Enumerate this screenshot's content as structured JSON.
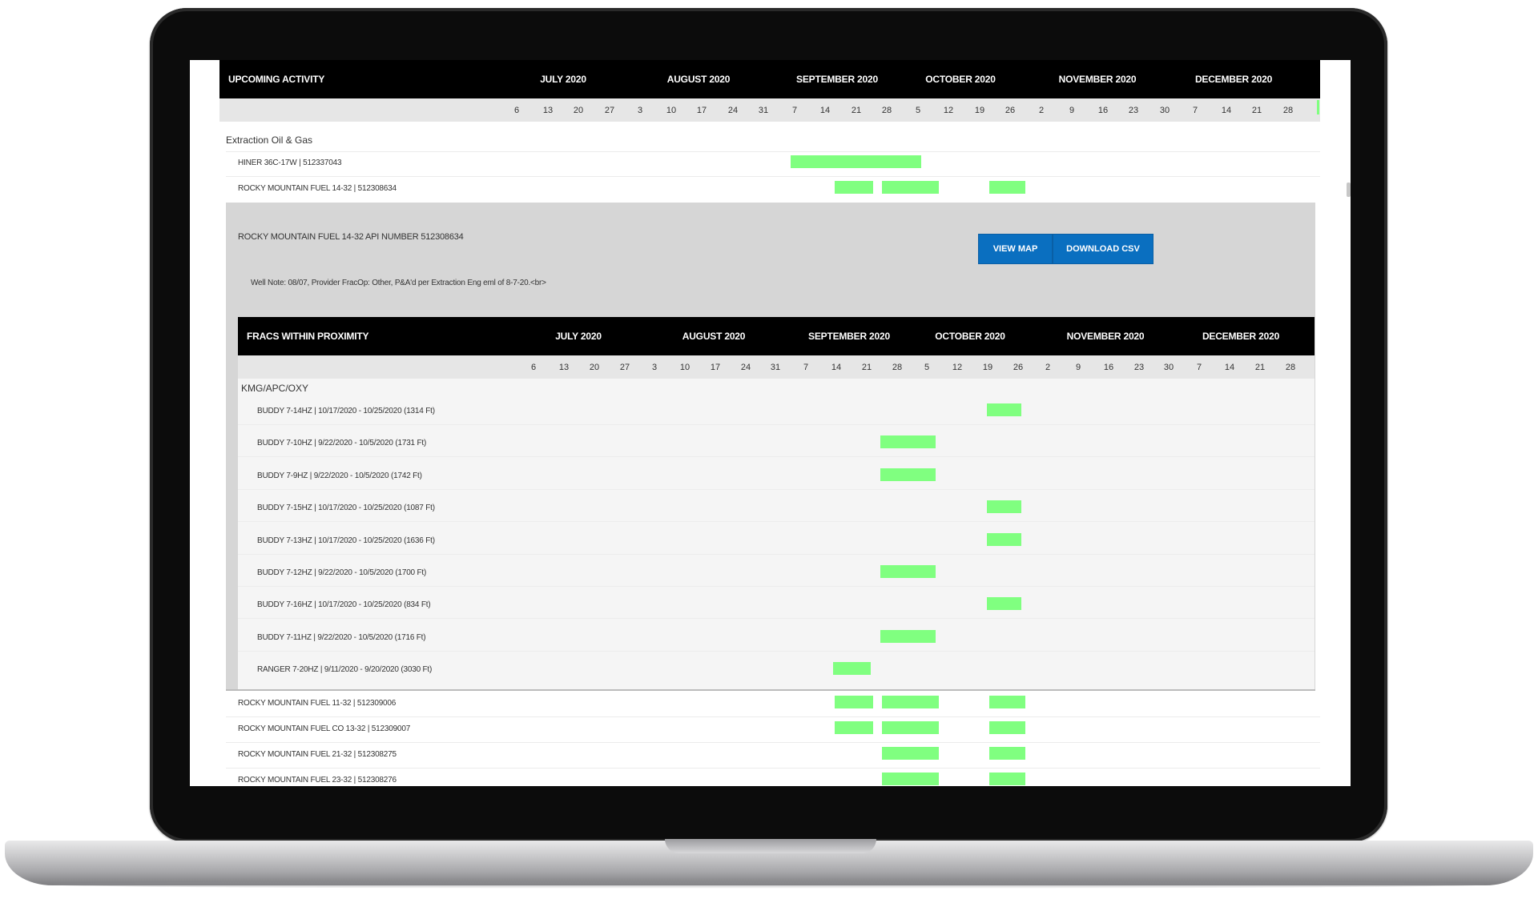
{
  "upcoming": {
    "title": "UPCOMING ACTIVITY",
    "months": [
      "JULY 2020",
      "AUGUST 2020",
      "SEPTEMBER 2020",
      "OCTOBER 2020",
      "NOVEMBER 2020",
      "DECEMBER 2020"
    ],
    "weeks": [
      "6",
      "13",
      "20",
      "27",
      "3",
      "10",
      "17",
      "24",
      "31",
      "7",
      "14",
      "21",
      "28",
      "5",
      "12",
      "19",
      "26",
      "2",
      "9",
      "16",
      "23",
      "30",
      "7",
      "14",
      "21",
      "28"
    ]
  },
  "operator": "Extraction Oil & Gas",
  "wells_top": [
    {
      "label": "HINER 36C-17W | 512337043"
    },
    {
      "label": "ROCKY MOUNTAIN FUEL 14-32 | 512308634"
    }
  ],
  "detail": {
    "title": "ROCKY MOUNTAIN FUEL 14-32 API NUMBER 512308634",
    "view_map": "VIEW MAP",
    "download_csv": "DOWNLOAD CSV",
    "note": "Well Note: 08/07, Provider FracOp: Other, P&A'd per Extraction Eng eml of 8-7-20.<br>"
  },
  "fracs": {
    "title": "FRACS WITHIN PROXIMITY",
    "months": [
      "JULY 2020",
      "AUGUST 2020",
      "SEPTEMBER 2020",
      "OCTOBER 2020",
      "NOVEMBER 2020",
      "DECEMBER 2020"
    ],
    "weeks": [
      "6",
      "13",
      "20",
      "27",
      "3",
      "10",
      "17",
      "24",
      "31",
      "7",
      "14",
      "21",
      "28",
      "5",
      "12",
      "19",
      "26",
      "2",
      "9",
      "16",
      "23",
      "30",
      "7",
      "14",
      "21",
      "28"
    ],
    "group": "KMG/APC/OXY",
    "rows": [
      {
        "label": "BUDDY 7-14HZ | 10/17/2020 - 10/25/2020 (1314 Ft)"
      },
      {
        "label": "BUDDY 7-10HZ | 9/22/2020 - 10/5/2020 (1731 Ft)"
      },
      {
        "label": "BUDDY 7-9HZ | 9/22/2020 - 10/5/2020 (1742 Ft)"
      },
      {
        "label": "BUDDY 7-15HZ | 10/17/2020 - 10/25/2020 (1087 Ft)"
      },
      {
        "label": "BUDDY 7-13HZ | 10/17/2020 - 10/25/2020 (1636 Ft)"
      },
      {
        "label": "BUDDY 7-12HZ | 9/22/2020 - 10/5/2020 (1700 Ft)"
      },
      {
        "label": "BUDDY 7-16HZ | 10/17/2020 - 10/25/2020 (834 Ft)"
      },
      {
        "label": "BUDDY 7-11HZ | 9/22/2020 - 10/5/2020 (1716 Ft)"
      },
      {
        "label": "RANGER 7-20HZ | 9/11/2020 - 9/20/2020 (3030 Ft)"
      }
    ]
  },
  "wells_bottom": [
    {
      "label": "ROCKY MOUNTAIN FUEL 11-32 | 512309006"
    },
    {
      "label": "ROCKY MOUNTAIN FUEL CO 13-32 | 512309007"
    },
    {
      "label": "ROCKY MOUNTAIN FUEL 21-32 | 512308275"
    },
    {
      "label": "ROCKY MOUNTAIN FUEL 23-32 | 512308276"
    }
  ],
  "colors": {
    "bar": "#80ff80",
    "button": "#0a6fc0",
    "header": "#000000"
  }
}
